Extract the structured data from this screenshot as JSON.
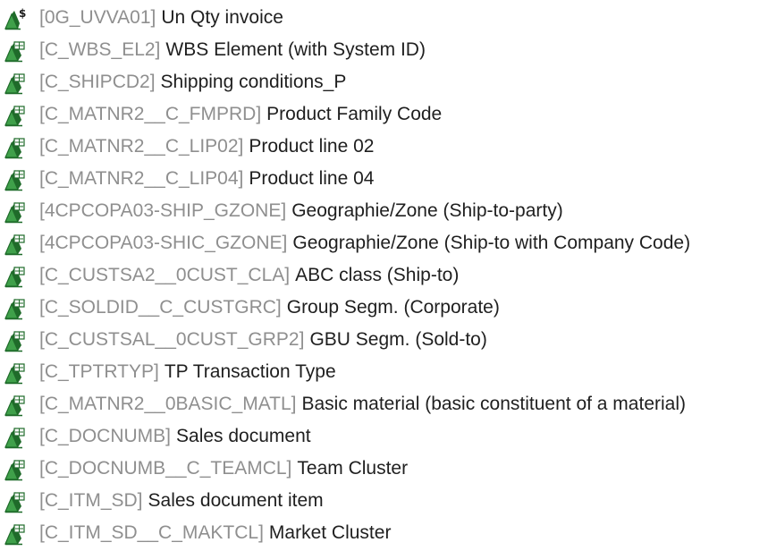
{
  "tree": {
    "items": [
      {
        "tech": "[0G_UVVA01]",
        "desc": "Un Qty invoice",
        "icon": "key-figure-icon"
      },
      {
        "tech": "[C_WBS_EL2]",
        "desc": "WBS Element (with System ID)",
        "icon": "characteristic-icon"
      },
      {
        "tech": "[C_SHIPCD2]",
        "desc": "Shipping conditions_P",
        "icon": "characteristic-icon"
      },
      {
        "tech": "[C_MATNR2__C_FMPRD]",
        "desc": "Product Family Code",
        "icon": "characteristic-icon"
      },
      {
        "tech": "[C_MATNR2__C_LIP02]",
        "desc": "Product line 02",
        "icon": "characteristic-icon"
      },
      {
        "tech": "[C_MATNR2__C_LIP04]",
        "desc": "Product line 04",
        "icon": "characteristic-icon"
      },
      {
        "tech": "[4CPCOPA03-SHIP_GZONE]",
        "desc": "Geographie/Zone (Ship-to-party)",
        "icon": "characteristic-icon"
      },
      {
        "tech": "[4CPCOPA03-SHIC_GZONE]",
        "desc": "Geographie/Zone (Ship-to with Company Code)",
        "icon": "characteristic-icon"
      },
      {
        "tech": "[C_CUSTSA2__0CUST_CLA]",
        "desc": "ABC class (Ship-to)",
        "icon": "characteristic-icon"
      },
      {
        "tech": "[C_SOLDID__C_CUSTGRC]",
        "desc": "Group Segm. (Corporate)",
        "icon": "characteristic-icon"
      },
      {
        "tech": "[C_CUSTSAL__0CUST_GRP2]",
        "desc": "GBU Segm. (Sold-to)",
        "icon": "characteristic-icon"
      },
      {
        "tech": "[C_TPTRTYP]",
        "desc": "TP Transaction Type",
        "icon": "characteristic-icon"
      },
      {
        "tech": "[C_MATNR2__0BASIC_MATL]",
        "desc": "Basic material (basic constituent of a material)",
        "icon": "characteristic-icon"
      },
      {
        "tech": "[C_DOCNUMB]",
        "desc": "Sales document",
        "icon": "characteristic-icon"
      },
      {
        "tech": "[C_DOCNUMB__C_TEAMCL]",
        "desc": "Team Cluster",
        "icon": "characteristic-icon"
      },
      {
        "tech": "[C_ITM_SD]",
        "desc": "Sales document item",
        "icon": "characteristic-icon"
      },
      {
        "tech": "[C_ITM_SD__C_MAKTCL]",
        "desc": "Market Cluster",
        "icon": "characteristic-icon"
      }
    ]
  },
  "colors": {
    "tech_text": "#8f8f8f",
    "desc_text": "#1f1f1f",
    "icon_green_dark": "#1f6b2a",
    "icon_green_light": "#3fa04a",
    "icon_dollar": "#1a1a1a"
  }
}
